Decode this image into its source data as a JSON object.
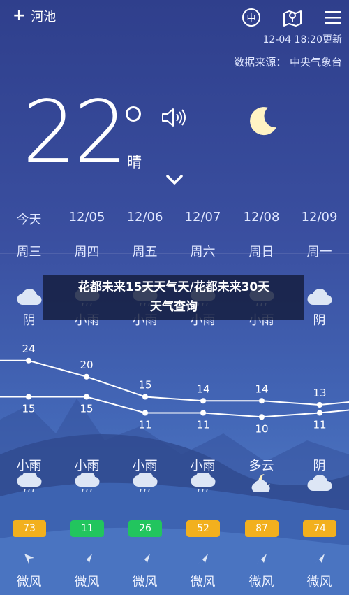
{
  "header": {
    "city": "河池",
    "plus": "+",
    "lang_icon_text": "中",
    "update_time": "12-04 18:20更新",
    "data_source": "数据来源：  中央气象台"
  },
  "current": {
    "temperature": "22",
    "condition": "晴",
    "icon": "moon-icon"
  },
  "forecast": {
    "dates": [
      "今天",
      "12/05",
      "12/06",
      "12/07",
      "12/08",
      "12/09"
    ],
    "weekdays": [
      "周三",
      "周四",
      "周五",
      "周六",
      "周日",
      "周一"
    ],
    "day_conditions": [
      "阴",
      "小雨",
      "小雨",
      "小雨",
      "小雨",
      "阴"
    ],
    "night_conditions": [
      "小雨",
      "小雨",
      "小雨",
      "小雨",
      "多云",
      "阴"
    ],
    "aqi": [
      {
        "value": "73",
        "color": "#f2b01e"
      },
      {
        "value": "11",
        "color": "#22c55e"
      },
      {
        "value": "26",
        "color": "#22c55e"
      },
      {
        "value": "52",
        "color": "#f2b01e"
      },
      {
        "value": "87",
        "color": "#f2b01e"
      },
      {
        "value": "74",
        "color": "#f2b01e"
      }
    ],
    "wind": [
      "微风",
      "微风",
      "微风",
      "微风",
      "微风",
      "微风"
    ]
  },
  "chart_data": {
    "type": "line",
    "categories": [
      "今天",
      "12/05",
      "12/06",
      "12/07",
      "12/08",
      "12/09"
    ],
    "series": [
      {
        "values": [
          24,
          20,
          15,
          14,
          14,
          13
        ]
      },
      {
        "values": [
          15,
          15,
          11,
          11,
          10,
          11
        ]
      }
    ],
    "ylim": [
      9,
      25
    ]
  },
  "banner": {
    "line1": "花都未来15天天气天/花都未来30天",
    "line2": "天气查询"
  }
}
